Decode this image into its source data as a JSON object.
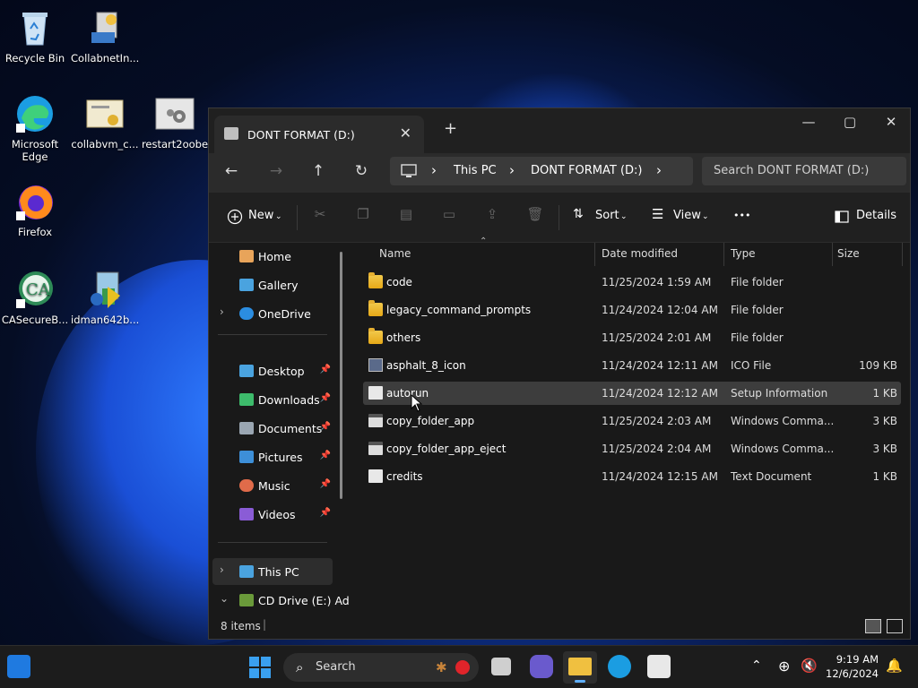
{
  "desktop": {
    "icons": [
      {
        "label": "Recycle Bin"
      },
      {
        "label": "CollabnetIn..."
      },
      {
        "label": "Microsoft Edge"
      },
      {
        "label": "collabvm_c..."
      },
      {
        "label": "restart2oobe"
      },
      {
        "label": "Firefox"
      },
      {
        "label": "CASecureB..."
      },
      {
        "label": "idman642b..."
      }
    ]
  },
  "window": {
    "tab_title": "DONT FORMAT (D:)",
    "tab_close": "✕",
    "new_tab": "+",
    "controls": {
      "minimize": "—",
      "maximize": "▢",
      "close": "✕"
    },
    "nav": {
      "back": "←",
      "forward": "→",
      "up": "↑",
      "refresh": "↻"
    },
    "breadcrumb": [
      "This PC",
      "DONT FORMAT (D:)"
    ],
    "breadcrumb_sep": "›",
    "search_placeholder": "Search DONT FORMAT (D:)",
    "toolbar": {
      "new_label": "New",
      "sort_label": "Sort",
      "view_label": "View",
      "more_label": "•••",
      "details_label": "Details"
    },
    "sidebar": {
      "top": [
        {
          "label": "Home",
          "icon": "home-icon",
          "color": "#e8a45a"
        },
        {
          "label": "Gallery",
          "icon": "gallery-icon",
          "color": "#4aa3df"
        },
        {
          "label": "OneDrive",
          "icon": "onedrive-icon",
          "color": "#2b8de0"
        }
      ],
      "pinned": [
        {
          "label": "Desktop",
          "icon": "desktop-icon",
          "color": "#4aa3df"
        },
        {
          "label": "Downloads",
          "icon": "downloads-icon",
          "color": "#3dbb6b"
        },
        {
          "label": "Documents",
          "icon": "documents-icon",
          "color": "#9aa6b2"
        },
        {
          "label": "Pictures",
          "icon": "pictures-icon",
          "color": "#3d8fd8"
        },
        {
          "label": "Music",
          "icon": "music-icon",
          "color": "#e06b4a"
        },
        {
          "label": "Videos",
          "icon": "videos-icon",
          "color": "#8a5cd6"
        }
      ],
      "bottom": [
        {
          "label": "This PC",
          "icon": "this-pc-icon",
          "color": "#4aa3df"
        },
        {
          "label": "CD Drive (E:) Ad",
          "icon": "cd-drive-icon",
          "color": "#6a9a3a"
        }
      ]
    },
    "columns": {
      "name": "Name",
      "date": "Date modified",
      "type": "Type",
      "size": "Size"
    },
    "files": [
      {
        "name": "code",
        "date": "11/25/2024 1:59 AM",
        "type": "File folder",
        "size": "",
        "kind": "folder"
      },
      {
        "name": "legacy_command_prompts",
        "date": "11/24/2024 12:04 AM",
        "type": "File folder",
        "size": "",
        "kind": "folder"
      },
      {
        "name": "others",
        "date": "11/25/2024 2:01 AM",
        "type": "File folder",
        "size": "",
        "kind": "folder"
      },
      {
        "name": "asphalt_8_icon",
        "date": "11/24/2024 12:11 AM",
        "type": "ICO File",
        "size": "109 KB",
        "kind": "ico"
      },
      {
        "name": "autorun",
        "date": "11/24/2024 12:12 AM",
        "type": "Setup Information",
        "size": "1 KB",
        "kind": "file"
      },
      {
        "name": "copy_folder_app",
        "date": "11/25/2024 2:03 AM",
        "type": "Windows Comma...",
        "size": "3 KB",
        "kind": "cmd"
      },
      {
        "name": "copy_folder_app_eject",
        "date": "11/25/2024 2:04 AM",
        "type": "Windows Comma...",
        "size": "3 KB",
        "kind": "cmd"
      },
      {
        "name": "credits",
        "date": "11/24/2024 12:15 AM",
        "type": "Text Document",
        "size": "1 KB",
        "kind": "file"
      }
    ],
    "selected_row": 4,
    "status": "8 items"
  },
  "taskbar": {
    "search_label": "Search",
    "time": "9:19 AM",
    "date": "12/6/2024"
  }
}
